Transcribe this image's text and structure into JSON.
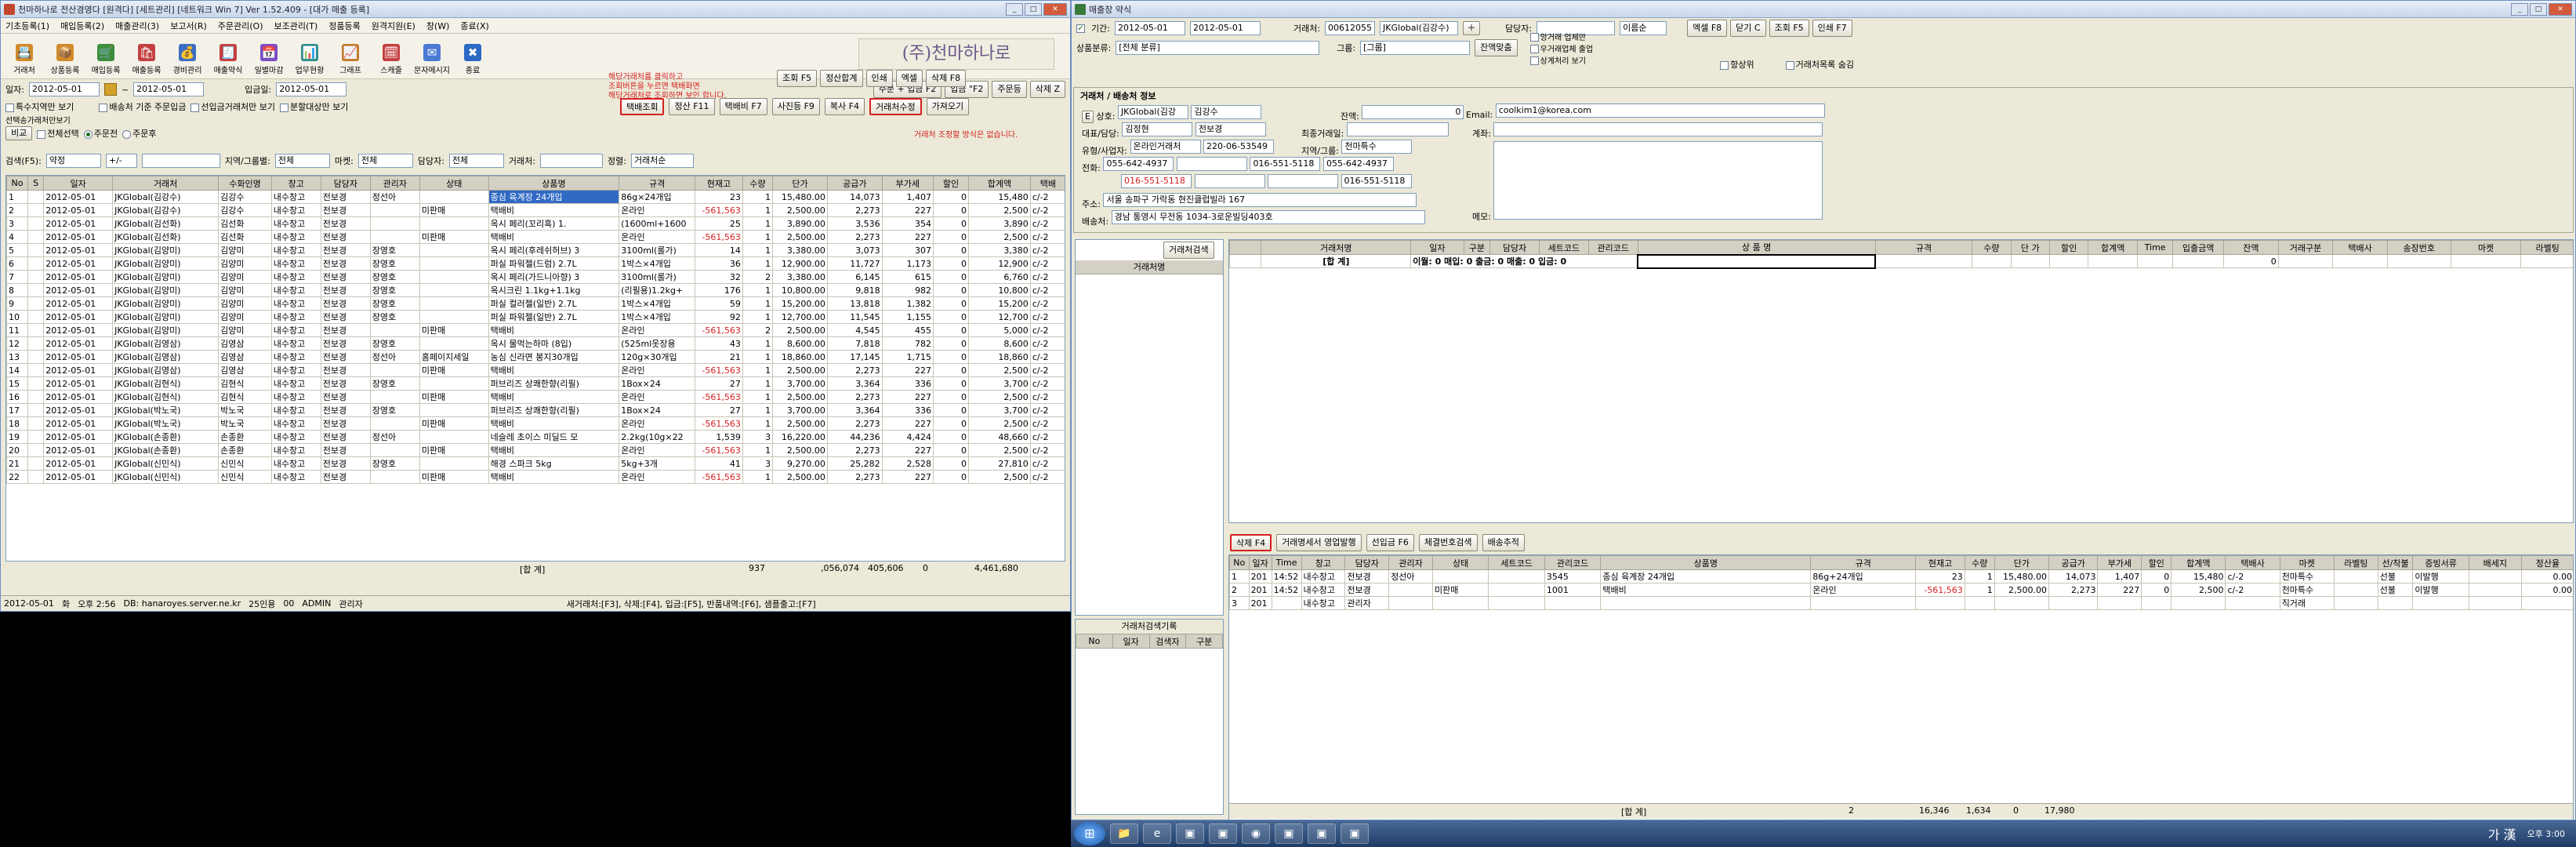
{
  "left_window": {
    "title": "천마하나로 전산경영다 [원격다] [세트관리] [네트워크 Win 7] Ver 1.52.409 - [대가 매출 등록]",
    "menu": [
      "기초등록(1)",
      "매입등록(2)",
      "매출관리(3)",
      "보고서(R)",
      "주문관리(O)",
      "보조관리(T)",
      "정품등록",
      "원격지원(E)",
      "창(W)",
      "종료(X)"
    ],
    "tools": [
      {
        "label": "거래처",
        "icon": "📇",
        "color": "#d38b2a"
      },
      {
        "label": "상품등록",
        "icon": "📦",
        "color": "#d38b2a"
      },
      {
        "label": "매입등록",
        "icon": "🛒",
        "color": "#3e8e3e"
      },
      {
        "label": "매출등록",
        "icon": "🛍",
        "color": "#c44040"
      },
      {
        "label": "경비관리",
        "icon": "💰",
        "color": "#3e6ec4"
      },
      {
        "label": "매출약식",
        "icon": "🧾",
        "color": "#c44040"
      },
      {
        "label": "일별마감",
        "icon": "📅",
        "color": "#7a4ec4"
      },
      {
        "label": "업무현황",
        "icon": "📊",
        "color": "#2f8f8f"
      },
      {
        "label": "그래프",
        "icon": "📈",
        "color": "#c47a2a"
      },
      {
        "label": "스캐줄",
        "icon": "🗓",
        "color": "#c44040"
      },
      {
        "label": "문자메시지",
        "icon": "✉",
        "color": "#4a7ad4"
      },
      {
        "label": "종료",
        "icon": "✖",
        "color": "#2a6ac4"
      }
    ],
    "brand": "(주)천마하나로",
    "filters": {
      "date_label": "일자:",
      "date_from": "2012-05-01",
      "date_to": "2012-05-01",
      "date_tilde": "~",
      "in_date_label": "입금일:",
      "in_date": "2012-05-01"
    },
    "top_buttons": [
      "주문 + 입금 F2",
      "입금 \"F2",
      "주문등",
      "삭제 Z"
    ],
    "options1": [
      "특수지역만 보기",
      "배송처 기준 주문입금",
      "선입금거래처만 보기",
      "분할대상만 보기"
    ],
    "option_under": "선택송가래처만보기",
    "options2": {
      "check_all": "전체선택",
      "radio1": "주문전",
      "radio2": "주문후",
      "bigyo": "비교"
    },
    "red_note_top": "해당거래처를 클릭하고\n조회버튼을 누르면 택배화면\n해당거래처로 조회하면 보인 합니다.",
    "buttons_row": [
      "조회 F5",
      "정산합계",
      "인쇄",
      "엑셀",
      "삭제 F8"
    ],
    "buttons_row2": [
      "택배조회",
      "정산 F11",
      "택배비 F7",
      "사진등 F9",
      "복사 F4",
      "거래처수정",
      "가져오기"
    ],
    "red_note_mid": "거래처 조정할 방식은 없습니다.",
    "search": {
      "label": "검색(F5):",
      "select": "약정",
      "op": "+/-",
      "region_label": "지역/그룹별:",
      "region": "전체",
      "mk_label": "마켓:",
      "mk": "전체",
      "staff_label": "담당자:",
      "staff": "전체",
      "cust_label": "거래처:",
      "state_label": "정렬:",
      "state": "거래처순"
    },
    "columns": [
      "No",
      "S",
      "일자",
      "거래처",
      "수화인명",
      "창고",
      "담당자",
      "관리자",
      "상태",
      "상품명",
      "규격",
      "현재고",
      "수량",
      "단가",
      "공급가",
      "부가세",
      "할인",
      "합계액",
      "택배"
    ],
    "rows": [
      [
        "1",
        "",
        "2012-05-01",
        "JKGlobal(김강수)",
        "김강수",
        "내수창고",
        "전보경",
        "정선아",
        "",
        "종심 육계장 24개입",
        "86g×24개입",
        "23",
        "1",
        "15,480.00",
        "14,073",
        "1,407",
        "0",
        "15,480",
        "c/-2"
      ],
      [
        "2",
        "",
        "2012-05-01",
        "JKGlobal(김강수)",
        "김강수",
        "내수창고",
        "전보경",
        "",
        "미판매",
        "택배비",
        "온라인",
        "-561,563",
        "1",
        "2,500.00",
        "2,273",
        "227",
        "0",
        "2,500",
        "c/-2"
      ],
      [
        "3",
        "",
        "2012-05-01",
        "JKGlobal(김선화)",
        "김선화",
        "내수창고",
        "전보경",
        "",
        "",
        "옥시 페리(꼬리흑) 1.",
        "(1600ml+1600",
        "25",
        "1",
        "3,890.00",
        "3,536",
        "354",
        "0",
        "3,890",
        "c/-2"
      ],
      [
        "4",
        "",
        "2012-05-01",
        "JKGlobal(김선화)",
        "김선화",
        "내수창고",
        "전보경",
        "",
        "미판매",
        "택배비",
        "온라인",
        "-561,563",
        "1",
        "2,500.00",
        "2,273",
        "227",
        "0",
        "2,500",
        "c/-2"
      ],
      [
        "5",
        "",
        "2012-05-01",
        "JKGlobal(김양미)",
        "김양미",
        "내수창고",
        "전보경",
        "장영호",
        "",
        "옥시 페리(후레쉬허브) 3",
        "3100ml(롤가)",
        "14",
        "1",
        "3,380.00",
        "3,073",
        "307",
        "0",
        "3,380",
        "c/-2"
      ],
      [
        "6",
        "",
        "2012-05-01",
        "JKGlobal(김양미)",
        "김양미",
        "내수창고",
        "전보경",
        "장영호",
        "",
        "퍼실 파워젤(드럼) 2.7L",
        "1박스×4개입",
        "36",
        "1",
        "12,900.00",
        "11,727",
        "1,173",
        "0",
        "12,900",
        "c/-2"
      ],
      [
        "7",
        "",
        "2012-05-01",
        "JKGlobal(김양미)",
        "김양미",
        "내수창고",
        "전보경",
        "장영호",
        "",
        "옥시 페리(가드니아향) 3",
        "3100ml(롤가)",
        "32",
        "2",
        "3,380.00",
        "6,145",
        "615",
        "0",
        "6,760",
        "c/-2"
      ],
      [
        "8",
        "",
        "2012-05-01",
        "JKGlobal(김양미)",
        "김양미",
        "내수창고",
        "전보경",
        "장영호",
        "",
        "옥시크린 1.1kg+1.1kg",
        "(리필용)1.2kg+",
        "176",
        "1",
        "10,800.00",
        "9,818",
        "982",
        "0",
        "10,800",
        "c/-2"
      ],
      [
        "9",
        "",
        "2012-05-01",
        "JKGlobal(김양미)",
        "김양미",
        "내수창고",
        "전보경",
        "장영호",
        "",
        "퍼실 컬러젤(일반) 2.7L",
        "1박스×4개입",
        "59",
        "1",
        "15,200.00",
        "13,818",
        "1,382",
        "0",
        "15,200",
        "c/-2"
      ],
      [
        "10",
        "",
        "2012-05-01",
        "JKGlobal(김양미)",
        "김양미",
        "내수창고",
        "전보경",
        "장영호",
        "",
        "퍼실 파워젤(일반) 2.7L",
        "1박스×4개입",
        "92",
        "1",
        "12,700.00",
        "11,545",
        "1,155",
        "0",
        "12,700",
        "c/-2"
      ],
      [
        "11",
        "",
        "2012-05-01",
        "JKGlobal(김양미)",
        "김양미",
        "내수창고",
        "전보경",
        "",
        "미판매",
        "택배비",
        "온라인",
        "-561,563",
        "2",
        "2,500.00",
        "4,545",
        "455",
        "0",
        "5,000",
        "c/-2"
      ],
      [
        "12",
        "",
        "2012-05-01",
        "JKGlobal(김영삼)",
        "김영삼",
        "내수창고",
        "전보경",
        "장영호",
        "",
        "옥시 물먹는하마 (8입)",
        "(525ml옷장용",
        "43",
        "1",
        "8,600.00",
        "7,818",
        "782",
        "0",
        "8,600",
        "c/-2"
      ],
      [
        "13",
        "",
        "2012-05-01",
        "JKGlobal(김영삼)",
        "김영삼",
        "내수창고",
        "전보경",
        "정선아",
        "홈페이지세일",
        "농심 신라면 봉지30개입",
        "120g×30개입",
        "21",
        "1",
        "18,860.00",
        "17,145",
        "1,715",
        "0",
        "18,860",
        "c/-2"
      ],
      [
        "14",
        "",
        "2012-05-01",
        "JKGlobal(김영삼)",
        "김영삼",
        "내수창고",
        "전보경",
        "",
        "미판매",
        "택배비",
        "온라인",
        "-561,563",
        "1",
        "2,500.00",
        "2,273",
        "227",
        "0",
        "2,500",
        "c/-2"
      ],
      [
        "15",
        "",
        "2012-05-01",
        "JKGlobal(김현식)",
        "김현식",
        "내수창고",
        "전보경",
        "장영호",
        "",
        "퍼브리즈 상쾌한향(리필)",
        "1Box×24",
        "27",
        "1",
        "3,700.00",
        "3,364",
        "336",
        "0",
        "3,700",
        "c/-2"
      ],
      [
        "16",
        "",
        "2012-05-01",
        "JKGlobal(김현식)",
        "김현식",
        "내수창고",
        "전보경",
        "",
        "미판매",
        "택배비",
        "온라인",
        "-561,563",
        "1",
        "2,500.00",
        "2,273",
        "227",
        "0",
        "2,500",
        "c/-2"
      ],
      [
        "17",
        "",
        "2012-05-01",
        "JKGlobal(박노국)",
        "박노국",
        "내수창고",
        "전보경",
        "장영호",
        "",
        "퍼브리즈 상쾌한향(리필)",
        "1Box×24",
        "27",
        "1",
        "3,700.00",
        "3,364",
        "336",
        "0",
        "3,700",
        "c/-2"
      ],
      [
        "18",
        "",
        "2012-05-01",
        "JKGlobal(박노국)",
        "박노국",
        "내수창고",
        "전보경",
        "",
        "미판매",
        "택배비",
        "온라인",
        "-561,563",
        "1",
        "2,500.00",
        "2,273",
        "227",
        "0",
        "2,500",
        "c/-2"
      ],
      [
        "19",
        "",
        "2012-05-01",
        "JKGlobal(손종환)",
        "손종환",
        "내수창고",
        "전보경",
        "정선아",
        "",
        "네슬레 초이스 미딜드 모",
        "2.2kg(10g×22",
        "1,539",
        "3",
        "16,220.00",
        "44,236",
        "4,424",
        "0",
        "48,660",
        "c/-2"
      ],
      [
        "20",
        "",
        "2012-05-01",
        "JKGlobal(손종환)",
        "손종환",
        "내수창고",
        "전보경",
        "",
        "미판매",
        "택배비",
        "온라인",
        "-561,563",
        "1",
        "2,500.00",
        "2,273",
        "227",
        "0",
        "2,500",
        "c/-2"
      ],
      [
        "21",
        "",
        "2012-05-01",
        "JKGlobal(신민식)",
        "신민식",
        "내수창고",
        "전보경",
        "장영호",
        "",
        "해경 스파크 5kg",
        "5kg+3개",
        "41",
        "3",
        "9,270.00",
        "25,282",
        "2,528",
        "0",
        "27,810",
        "c/-2"
      ],
      [
        "22",
        "",
        "2012-05-01",
        "JKGlobal(신민식)",
        "신민식",
        "내수창고",
        "전보경",
        "",
        "미판매",
        "택배비",
        "온라인",
        "-561,563",
        "1",
        "2,500.00",
        "2,273",
        "227",
        "0",
        "2,500",
        "c/-2"
      ]
    ],
    "footer": {
      "label": "[합 계]",
      "qty": "937",
      "supply": ",056,074",
      "vat": "405,606",
      "disc": "0",
      "total": "4,461,680"
    },
    "status": [
      "2012-05-01",
      "화",
      "오후 2:56",
      "DB: hanaroyes.server.ne.kr",
      "25인용",
      "00",
      "ADMIN",
      "관리자",
      "새거래처:[F3], 삭제:[F4], 입금:[F5], 반품내역:[F6], 샘플출고:[F7]"
    ]
  },
  "right_window": {
    "title": "매출장 약식",
    "period_label": "기간:",
    "date_from": "2012-05-01",
    "date_to": "2012-05-01",
    "cust_label": "거래처:",
    "cust_code": "00612055",
    "cust_name": "JKGlobal(김강수)",
    "staff_label": "담당자:",
    "name_opt": "이름순",
    "checks": [
      "앙거래 업체만",
      "우거래업체 출업",
      "상계처리 보기"
    ],
    "btns": [
      "엑셀 F8",
      "닫기 C",
      "조회 F5",
      "인쇄 F7"
    ],
    "item_cat_label": "상품분류:",
    "item_cat": "[전체 분류]",
    "group_label": "그룹:",
    "group": "[그룹]",
    "balance_btn": "잔액맞춤",
    "hangsang": "항상위",
    "cust_list_btn": "거래처목록 숨김",
    "info_title": "거래처 / 배송처 정보",
    "info": {
      "biz_label": "상호:",
      "biz": "JKGlobal(김강",
      "owner": "김강수",
      "balance_label": "잔액:",
      "balance": "0",
      "rep_label": "대표/담당:",
      "rep1": "김정현",
      "rep2": "전보경",
      "last_label": "최종거래일:",
      "type_label": "유형/사업자:",
      "type": "온라인거래처",
      "bizno": "220-06-53549",
      "region_label": "지역/그룹:",
      "region": "천마특수",
      "tel_label": "전화:",
      "tel": "055-642-4937",
      "tel2": "016-551-5118",
      "tel3": "055-642-4937",
      "hp": "016-551-5118",
      "hp2": "016-551-5118",
      "addr_label": "주소:",
      "addr": "서울 송파구 가락동 현진클럽빌라 167",
      "ship_label": "배송처:",
      "ship": "경남 통영시 무전동 1034-3로운빌딩403호",
      "email_label": "Email:",
      "email": "coolkim1@korea.com",
      "acct_label": "계좌:",
      "memo_label": "메모:"
    },
    "cust_search_btn": "거래처검색",
    "cust_list_header": "거래처명",
    "ledger_cols": [
      "거래처명",
      "일자",
      "구분",
      "담당자",
      "세트코드",
      "관리코드",
      "상 품 명",
      "규격",
      "수량",
      "단 가",
      "할인",
      "합계액",
      "Time",
      "입출금액",
      "잔액",
      "거래구분",
      "택배사",
      "송장번호",
      "마켓",
      "라벨팅"
    ],
    "ledger_sum": {
      "label": "[합 계]",
      "text": "이월: 0  매입: 0  출금: 0  매출: 0  입금: 0",
      "balance": "0"
    },
    "lower_btns": [
      "삭제 F4",
      "거래명세서 영업발행",
      "선입금 F6",
      "체결번호검색",
      "배송추적"
    ],
    "lower_cols": [
      "No",
      "일자",
      "Time",
      "창고",
      "담당자",
      "관리자",
      "상태",
      "세트코드",
      "관리코드",
      "상품명",
      "규격",
      "현재고",
      "수량",
      "단가",
      "공급가",
      "부가세",
      "할인",
      "합계액",
      "택배사",
      "마켓",
      "라벨팅",
      "선/착불",
      "증빙서류",
      "배세지",
      "정산율"
    ],
    "lower_rows": [
      [
        "1",
        "201",
        "14:52",
        "내수창고",
        "전보경",
        "정선아",
        "",
        "",
        "3545",
        "종심 육계장 24개입",
        "86g+24개입",
        "23",
        "1",
        "15,480.00",
        "14,073",
        "1,407",
        "0",
        "15,480",
        "c/-2",
        "천마특수",
        "",
        "선불",
        "이발행",
        "",
        "0.00"
      ],
      [
        "2",
        "201",
        "14:52",
        "내수창고",
        "전보경",
        "",
        "미판매",
        "",
        "1001",
        "택배비",
        "온라인",
        "-561,563",
        "1",
        "2,500.00",
        "2,273",
        "227",
        "0",
        "2,500",
        "c/-2",
        "천마특수",
        "",
        "선불",
        "이발행",
        "",
        "0.00"
      ],
      [
        "3",
        "201",
        "",
        "내수창고",
        "관리자",
        "",
        "",
        "",
        "",
        "",
        "",
        "",
        "",
        "",
        "",
        "",
        "",
        "",
        "",
        "직거래",
        "",
        "",
        "",
        "",
        ""
      ]
    ],
    "hist_title": "거래처검색기록",
    "hist_cols": [
      "No",
      "일자",
      "검색자",
      "구분"
    ],
    "lower_footer": {
      "label": "[합 계]",
      "qty": "2",
      "supply": "16,346",
      "vat": "1,634",
      "disc": "0",
      "total": "17,980"
    }
  },
  "taskbar": {
    "time": "오후 3:00",
    "lang": "가 漢"
  }
}
